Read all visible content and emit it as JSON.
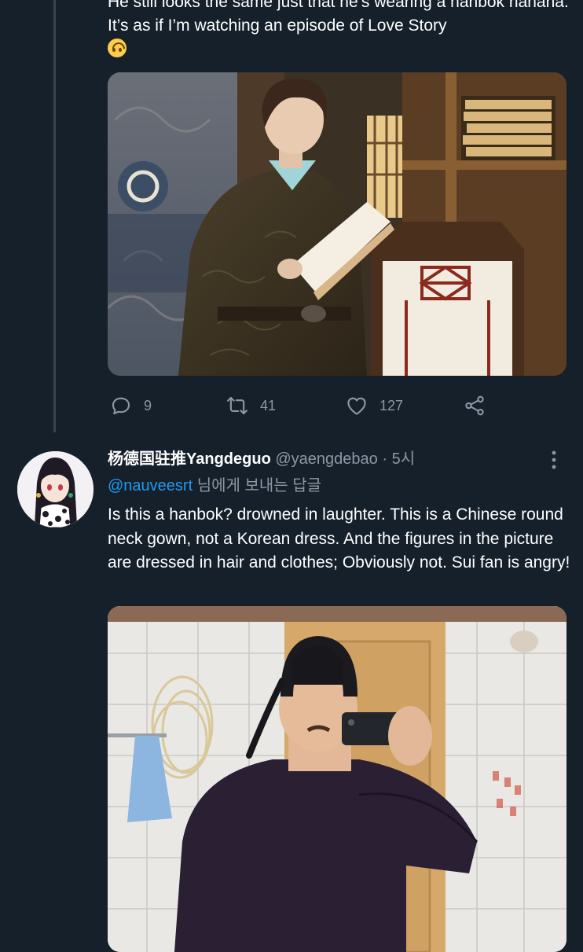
{
  "tweet1": {
    "text": "He still looks the same just that he’s wearing a hanbok hahaha. It’s as if I’m watching an episode of Love Story",
    "emoji": "upside-down-face",
    "actions": {
      "reply_count": "9",
      "retweet_count": "41",
      "like_count": "127"
    }
  },
  "tweet2": {
    "display_name": "杨德国驻推Yangdeguo",
    "handle": "@yaengdebao",
    "separator": "·",
    "time": "5시",
    "reply_to_mention": "@nauveesrt",
    "reply_to_suffix": "님에게 보내는 답글",
    "text": "Is this a hanbok? drowned in laughter. This is a Chinese round neck gown, not a Korean dress. And the figures in the picture are dressed in hair and clothes; Obviously not. Sui fan is angry!"
  },
  "colors": {
    "background": "#15202b",
    "muted_text": "#8b98a5",
    "link": "#1d9bf0",
    "thread_line": "#38444d"
  },
  "icons": [
    "reply-icon",
    "retweet-icon",
    "like-icon",
    "share-icon",
    "more-options-icon"
  ]
}
